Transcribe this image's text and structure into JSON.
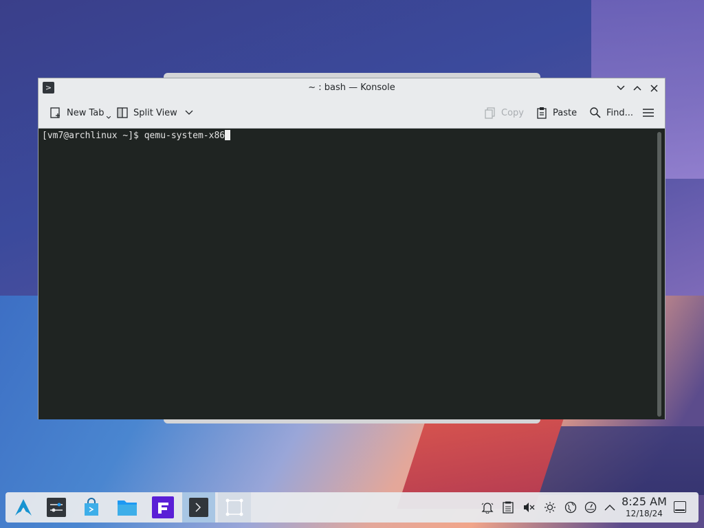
{
  "window": {
    "title": "~ : bash — Konsole",
    "app_icon_glyph": ">",
    "minimize_glyph": "﹀",
    "maximize_glyph": "︿",
    "close_glyph": "✕"
  },
  "toolbar": {
    "new_tab_label": "New Tab",
    "split_view_label": "Split View",
    "copy_label": "Copy",
    "paste_label": "Paste",
    "find_label": "Find..."
  },
  "terminal": {
    "prompt": "[vm7@archlinux ~]$ ",
    "command": "qemu-system-x86"
  },
  "taskbar": {
    "pinned": [
      {
        "name": "app-launcher",
        "icon": "arch-logo-icon"
      },
      {
        "name": "system-settings",
        "icon": "settings-icon"
      },
      {
        "name": "discover",
        "icon": "store-icon"
      },
      {
        "name": "dolphin",
        "icon": "folder-icon"
      },
      {
        "name": "foliate",
        "icon": "f-app-icon"
      },
      {
        "name": "konsole",
        "icon": "terminal-icon",
        "active": true
      },
      {
        "name": "spectacle",
        "icon": "screenshot-icon"
      }
    ],
    "tray": [
      "notifications-icon",
      "clipboard-icon",
      "volume-muted-icon",
      "brightness-icon",
      "network-icon",
      "power-icon",
      "expand-tray-icon"
    ],
    "clock_time": "8:25 AM",
    "clock_date": "12/18/24"
  },
  "colors": {
    "terminal_bg": "#1f2422",
    "chrome_bg": "#e9ebed",
    "active_task": "#a8c6e4",
    "accent": "#1d99f3"
  }
}
